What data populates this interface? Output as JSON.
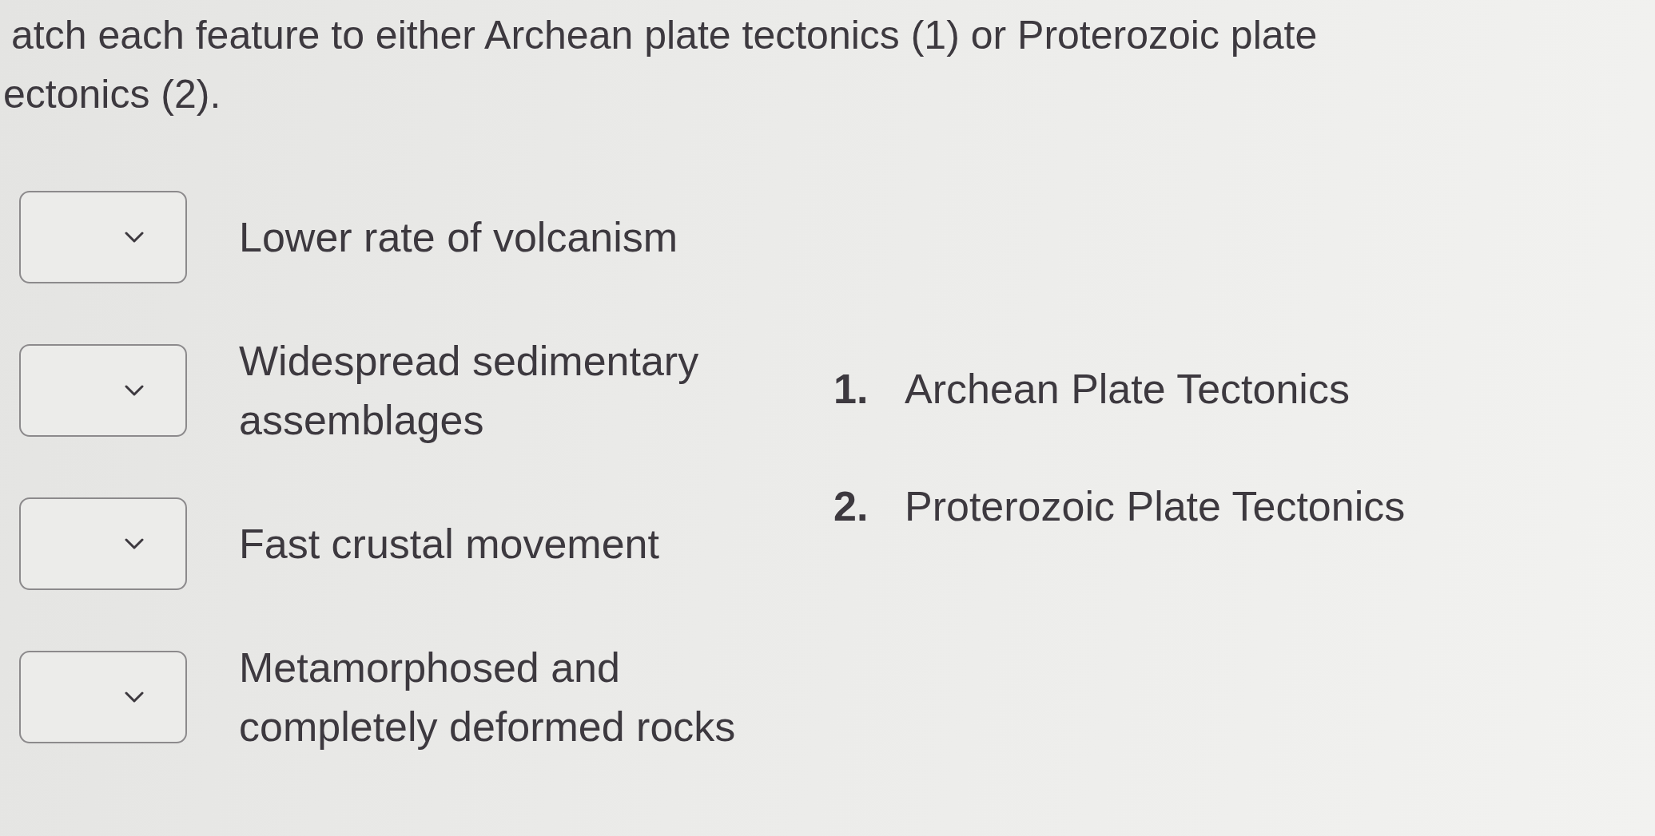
{
  "prompt": {
    "lines": [
      "atch each feature to either Archean plate tectonics (1) or Proterozoic plate",
      "ectonics (2)."
    ]
  },
  "features": [
    {
      "text": "Lower rate of volcanism"
    },
    {
      "text": "Widespread sedimentary assemblages"
    },
    {
      "text": "Fast crustal movement"
    },
    {
      "text": "Metamorphosed and completely deformed rocks"
    }
  ],
  "options": [
    {
      "number": "1.",
      "text": "Archean Plate Tectonics"
    },
    {
      "number": "2.",
      "text": "Proterozoic Plate Tectonics"
    }
  ]
}
